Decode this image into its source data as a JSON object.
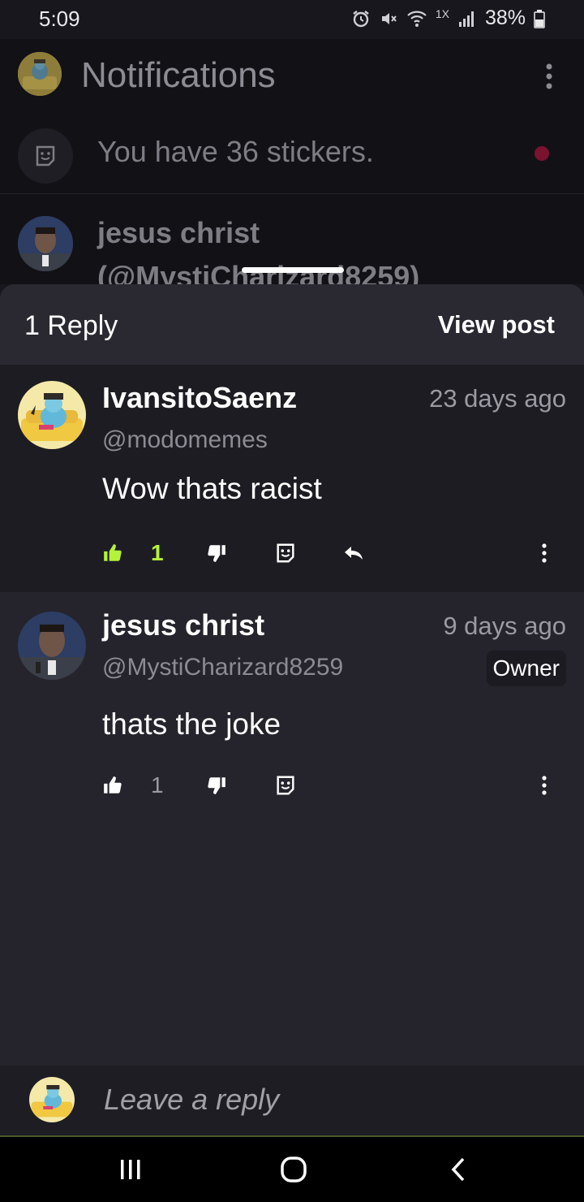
{
  "status_bar": {
    "time": "5:09",
    "network_label": "1X",
    "battery": "38%"
  },
  "background": {
    "title": "Notifications",
    "stickers_text": "You have 36 stickers.",
    "notif_name": "jesus christ",
    "notif_handle": "(@MystiCharizard8259)"
  },
  "sheet": {
    "reply_count": "1 Reply",
    "view_post": "View post",
    "comments": [
      {
        "name": "IvansitoSaenz",
        "handle": "@modomemes",
        "time": "23 days ago",
        "text": "Wow thats racist",
        "likes": "1",
        "liked": true
      },
      {
        "name": "jesus christ",
        "handle": "@MystiCharizard8259",
        "time": "9 days ago",
        "badge": "Owner",
        "text": "thats the joke",
        "likes": "1",
        "liked": false
      }
    ]
  },
  "reply": {
    "placeholder": "Leave a reply"
  },
  "colors": {
    "liked_accent": "#b5f23a",
    "notification_dot": "#7a1230",
    "sheet_background": "#25242c"
  },
  "icons": [
    "alarm-icon",
    "mute-icon",
    "wifi-icon",
    "signal-icon",
    "battery-icon",
    "more-vert-icon",
    "sticker-icon",
    "thumbs-up-icon",
    "thumbs-down-icon",
    "reply-arrow-icon",
    "recents-icon",
    "home-icon",
    "back-icon"
  ]
}
